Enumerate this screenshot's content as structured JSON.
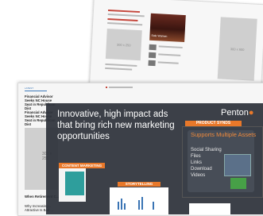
{
  "back_page": {
    "ad_label_left": "300 x 250",
    "ad_label_right": "300 x 600",
    "photo_caption": "Sole Women"
  },
  "front_page": {
    "tab": "LATEST",
    "headlines": [
      "Financial Advisor Seeks NC House Seat in Republican Dist",
      "Financial Advisor Seeks NC House Seat in Republican Dist"
    ],
    "ad_label": "300 x 250",
    "bottom_items": [
      "When Retirement C...",
      "Why Increasing... Attractive Is Bad ..."
    ]
  },
  "overlay": {
    "headline": "Innovative, high impact ads that bring rich new marketing opportunities",
    "logo_text": "Penton",
    "product_tab": "PRODUCT SYNDS",
    "panel_title": "Supports Multiple Assets",
    "panel_items": [
      "Social Sharing",
      "Files",
      "Links",
      "Download",
      "Videos"
    ],
    "content_marketing_tag": "CONTENT MARKETING",
    "storytelling_tag": "STORYTELLING"
  }
}
